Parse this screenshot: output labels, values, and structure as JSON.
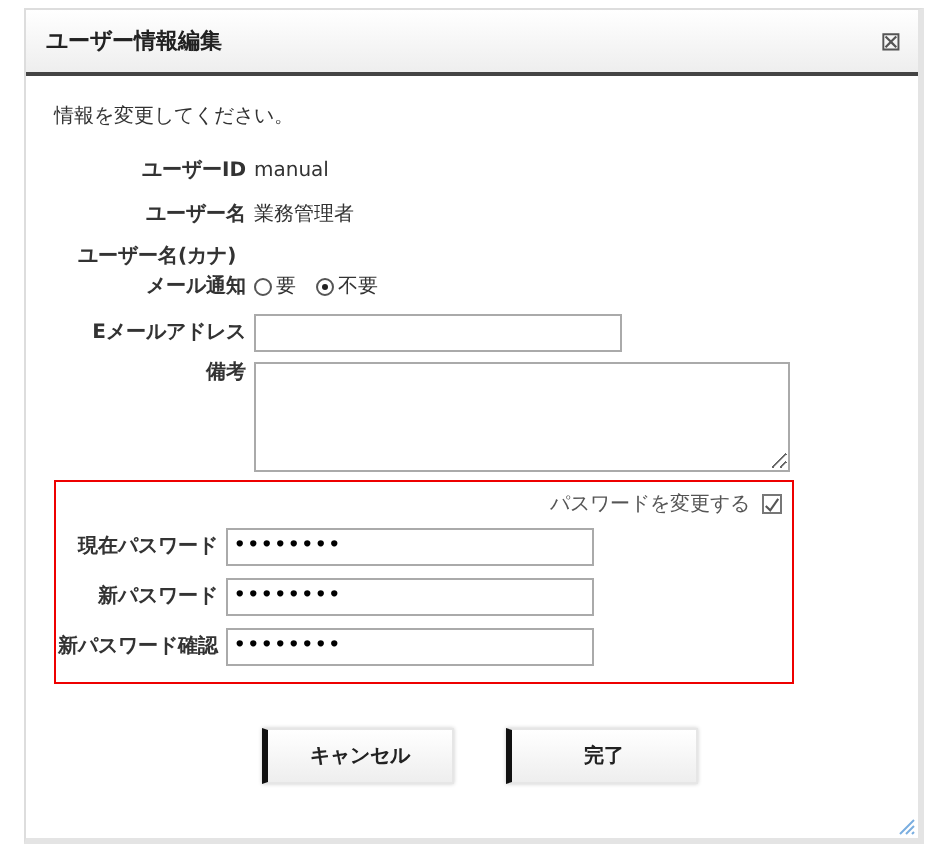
{
  "dialog": {
    "title": "ユーザー情報編集",
    "close_label": "⊠"
  },
  "message": "情報を変更してください。",
  "fields": [
    {
      "kind": "text",
      "label": "ユーザーID",
      "value": "manual"
    },
    {
      "kind": "text",
      "label": "ユーザー名",
      "value": "業務管理者"
    },
    {
      "kind": "label",
      "label": "ユーザー名(カナ)"
    },
    {
      "kind": "radio",
      "label": "メール通知",
      "options": [
        {
          "label": "要",
          "selected": false
        },
        {
          "label": "不要",
          "selected": true
        }
      ]
    },
    {
      "kind": "input",
      "label": "Eメールアドレス"
    },
    {
      "kind": "textarea",
      "label": "備考"
    }
  ],
  "password": {
    "toggle_label": "パスワードを変更する",
    "checked": true,
    "fields": [
      {
        "label": "現在パスワード",
        "value": "••••••••"
      },
      {
        "label": "新パスワード",
        "value": "••••••••"
      },
      {
        "label": "新パスワード確認",
        "value": "••••••••"
      }
    ]
  },
  "buttons": [
    "キャンセル",
    "完了"
  ]
}
